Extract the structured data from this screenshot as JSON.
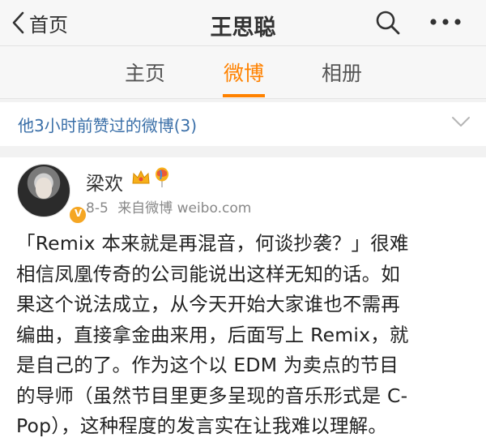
{
  "nav": {
    "back_label": "首页",
    "title": "王思聪"
  },
  "tabs": [
    {
      "label": "主页"
    },
    {
      "label": "微博"
    },
    {
      "label": "相册"
    }
  ],
  "liked": {
    "text": "他3小时前赞过的微博(3)"
  },
  "post": {
    "author": "梁欢",
    "date": "8-5",
    "source": "来自微博 weibo.com",
    "content_lines": [
      "「Remix 本来就是再混音，何谈抄袭？」很难",
      "相信凤凰传奇的公司能说出这样无知的话。如",
      "果这个说法成立，从今天开始大家谁也不需再",
      "编曲，直接拿金曲来用，后面写上 Remix，就",
      "是自己的了。作为这个以 EDM 为卖点的节目",
      "的导师（虽然节目里更多呈现的音乐形式是 C-",
      "Pop），这种程度的发言实在让我难以理解。"
    ]
  },
  "colors": {
    "accent": "#ff8200",
    "link": "#3a6fa8",
    "verified": "#f5a623"
  }
}
